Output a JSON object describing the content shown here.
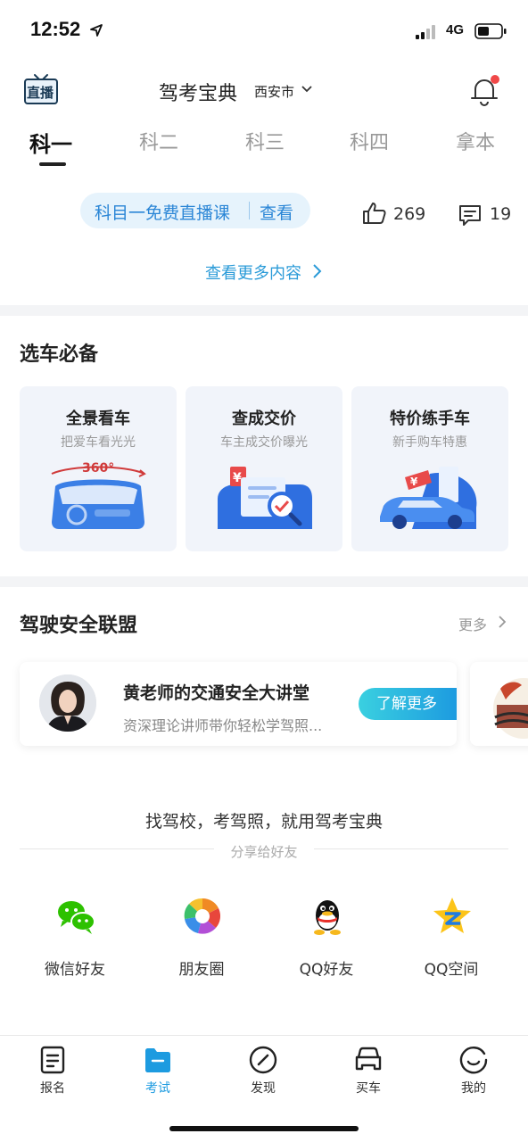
{
  "status": {
    "time": "12:52",
    "network": "4G"
  },
  "header": {
    "live_badge": "直播",
    "title": "驾考宝典",
    "city": "西安市"
  },
  "tabs": [
    {
      "label": "科一",
      "active": true
    },
    {
      "label": "科二",
      "active": false
    },
    {
      "label": "科三",
      "active": false
    },
    {
      "label": "科四",
      "active": false
    },
    {
      "label": "拿本",
      "active": false
    }
  ],
  "live": {
    "course": "科目一免费直播课",
    "action": "查看"
  },
  "stats": {
    "likes": "269",
    "comments": "19"
  },
  "more_content": "查看更多内容",
  "car_section": {
    "title": "选车必备",
    "cards": [
      {
        "title": "全景看车",
        "subtitle": "把爱车看光光",
        "badge": "360°"
      },
      {
        "title": "查成交价",
        "subtitle": "车主成交价曝光",
        "badge": "¥"
      },
      {
        "title": "特价练手车",
        "subtitle": "新手购车特惠",
        "badge": "¥"
      }
    ]
  },
  "safety_section": {
    "title": "驾驶安全联盟",
    "more": "更多",
    "teacher": {
      "name": "黄老师的交通安全大讲堂",
      "desc": "资深理论讲师带你轻松学驾照...",
      "button": "了解更多"
    }
  },
  "share": {
    "slogan": "找驾校，考驾照，就用驾考宝典",
    "label": "分享给好友",
    "items": [
      {
        "label": "微信好友",
        "icon": "wechat-icon"
      },
      {
        "label": "朋友圈",
        "icon": "moments-icon"
      },
      {
        "label": "QQ好友",
        "icon": "qq-icon"
      },
      {
        "label": "QQ空间",
        "icon": "qzone-icon"
      }
    ]
  },
  "bottom_nav": [
    {
      "label": "报名",
      "icon": "signup-icon",
      "active": false
    },
    {
      "label": "考试",
      "icon": "folder-icon",
      "active": true
    },
    {
      "label": "发现",
      "icon": "compass-icon",
      "active": false
    },
    {
      "label": "买车",
      "icon": "car-icon",
      "active": false
    },
    {
      "label": "我的",
      "icon": "profile-icon",
      "active": false
    }
  ],
  "colors": {
    "accent": "#1d9be0",
    "link": "#2b9bd8",
    "notification_dot": "#f04848"
  }
}
